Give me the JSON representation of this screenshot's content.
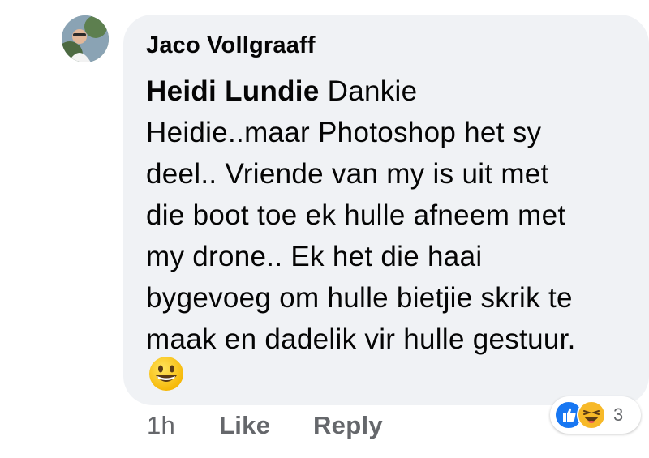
{
  "comment": {
    "author": "Jaco Vollgraaff",
    "mention": "Heidi Lundie",
    "text_after_mention": " Dankie",
    "text_lines": [
      "Heidie..maar Photoshop het sy",
      "deel.. Vriende van my is uit met",
      "die boot toe ek hulle afneem met",
      "my drone.. Ek het die haai",
      "bygevoeg om hulle bietjie skrik te",
      "maak en dadelik vir hulle gestuur."
    ],
    "emoji": "grinning-face"
  },
  "actions": {
    "time": "1h",
    "like_label": "Like",
    "reply_label": "Reply"
  },
  "reactions": {
    "icons": [
      "like-icon",
      "haha-icon"
    ],
    "count": "3"
  },
  "colors": {
    "bubble": "#f0f2f5",
    "text": "#050505",
    "muted": "#65676b",
    "like_blue": "#1877f2",
    "haha_yellow": "#f7b928"
  }
}
